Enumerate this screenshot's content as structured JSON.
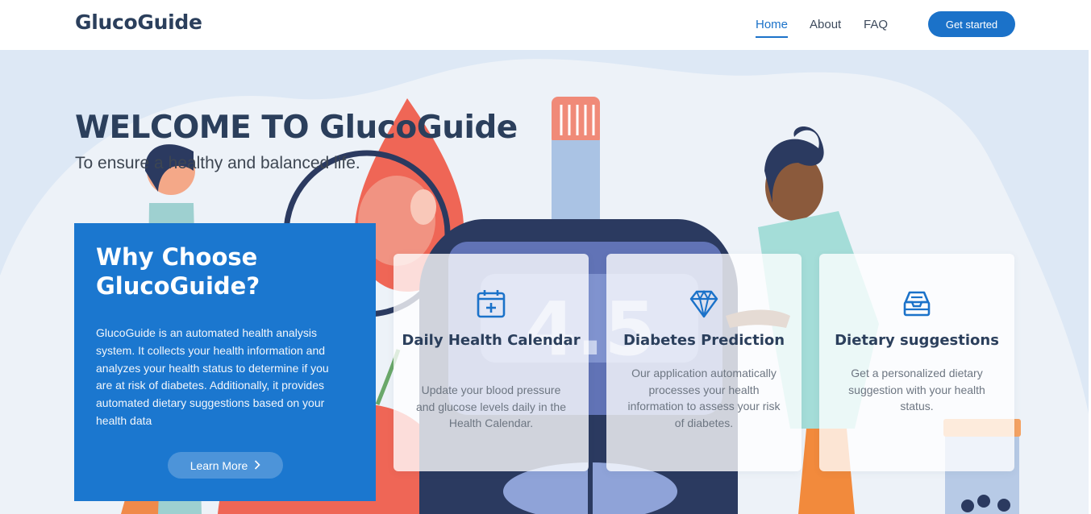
{
  "header": {
    "brand": "GlucoGuide",
    "nav": {
      "home": "Home",
      "about": "About",
      "faq": "FAQ"
    },
    "cta": "Get started"
  },
  "hero": {
    "title": "WELCOME TO GlucoGuide",
    "subtitle": "To ensure a healthy and balanced life.",
    "meter_reading": "4.5"
  },
  "why": {
    "title": "Why Choose GlucoGuide?",
    "body": "GlucoGuide is an automated health analysis system. It collects your health information and analyzes your health status to determine if you are at risk of diabetes. Additionally, it provides automated dietary suggestions based on your health data",
    "button": "Learn More",
    "button_icon": "chevron-right-icon"
  },
  "features": [
    {
      "icon": "calendar-plus-icon",
      "title": "Daily Health Calendar",
      "text": "Update your blood pressure and glucose levels daily in the Health Calendar."
    },
    {
      "icon": "diamond-icon",
      "title": "Diabetes Prediction",
      "text": "Our application automatically processes your health information to assess your risk of diabetes."
    },
    {
      "icon": "inbox-tray-icon",
      "title": "Dietary suggestions",
      "text": "Get a personalized dietary suggestion with your health status."
    }
  ],
  "colors": {
    "primary": "#1b72c9",
    "heading": "#2b3f5c",
    "hero_bg": "#dde8f5"
  }
}
